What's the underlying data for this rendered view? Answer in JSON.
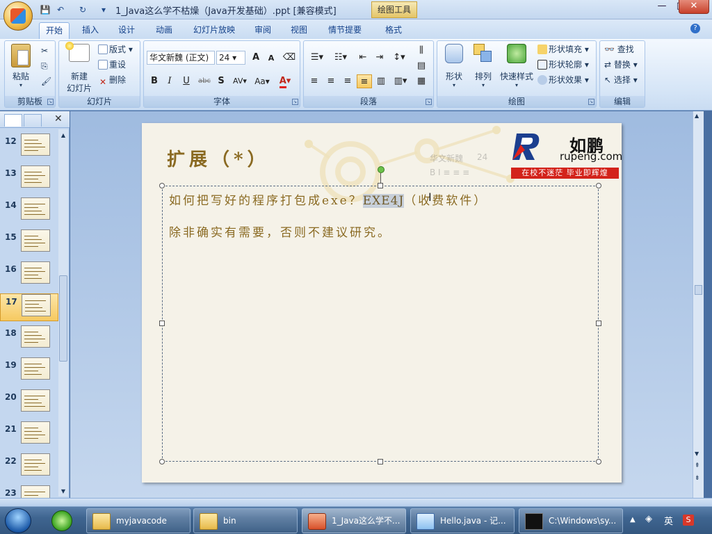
{
  "window": {
    "title": "1_Java这么学不枯燥（Java开发基础）.ppt [兼容模式]",
    "contextual_tab": "绘图工具",
    "controls": {
      "minimize": "—",
      "maximize": "□",
      "close": "✕"
    }
  },
  "quick_access": {
    "save": "💾",
    "undo": "↶",
    "redo": "↻",
    "more": "▾"
  },
  "tabs": [
    {
      "label": "开始",
      "active": true
    },
    {
      "label": "插入"
    },
    {
      "label": "设计"
    },
    {
      "label": "动画"
    },
    {
      "label": "幻灯片放映"
    },
    {
      "label": "审阅"
    },
    {
      "label": "视图"
    },
    {
      "label": "情节提要"
    },
    {
      "label": "格式"
    }
  ],
  "ribbon": {
    "clipboard": {
      "label": "剪贴板",
      "paste": "粘贴"
    },
    "slides": {
      "label": "幻灯片",
      "new_slide_line1": "新建",
      "new_slide_line2": "幻灯片",
      "layout": "版式",
      "reset": "重设",
      "delete": "删除"
    },
    "font": {
      "label": "字体",
      "font_name": "华文新魏 (正文)",
      "font_size": "24",
      "grow": "A",
      "shrink": "A",
      "bold": "B",
      "italic": "I",
      "underline": "U",
      "strike": "abc",
      "shadow": "S",
      "spacing": "AV",
      "case": "Aa",
      "color": "A"
    },
    "paragraph": {
      "label": "段落"
    },
    "drawing": {
      "label": "绘图",
      "shapes": "形状",
      "arrange": "排列",
      "quick_styles": "快速样式",
      "fill": "形状填充",
      "outline": "形状轮廓",
      "effects": "形状效果"
    },
    "editing": {
      "label": "编辑",
      "find": "查找",
      "replace": "替换",
      "select": "选择"
    }
  },
  "slide_panel": {
    "thumbnails": [
      {
        "number": "12"
      },
      {
        "number": "13"
      },
      {
        "number": "14"
      },
      {
        "number": "15"
      },
      {
        "number": "16"
      },
      {
        "number": "17",
        "selected": true
      },
      {
        "number": "18"
      },
      {
        "number": "19"
      },
      {
        "number": "20"
      },
      {
        "number": "21"
      },
      {
        "number": "22"
      },
      {
        "number": "23"
      }
    ]
  },
  "slide": {
    "title": "扩展（*）",
    "line1_before": "如何把写好的程序打包成exe？",
    "line1_selected": "EXE4J",
    "line1_after": "（收费软件）",
    "line2": "除非确实有需要，否则不建议研究。",
    "logo": {
      "name_cn": "如鹏",
      "domain": "rupeng.com",
      "slogan": "在校不迷茫  毕业即辉煌"
    },
    "mini_toolbar": {
      "font": "华文新魏",
      "size": "24"
    }
  },
  "taskbar": {
    "items": [
      {
        "label": "myjavacode"
      },
      {
        "label": "bin"
      },
      {
        "label": "1_Java这么学不...",
        "active": true
      },
      {
        "label": "Hello.java - 记..."
      },
      {
        "label": "C:\\Windows\\sy..."
      }
    ],
    "tray": {
      "ime": "英",
      "arrow": "▲"
    }
  },
  "colors": {
    "slide_text": "#8a6a22",
    "logo_red": "#d3231b",
    "selection": "#c7cfd9"
  }
}
